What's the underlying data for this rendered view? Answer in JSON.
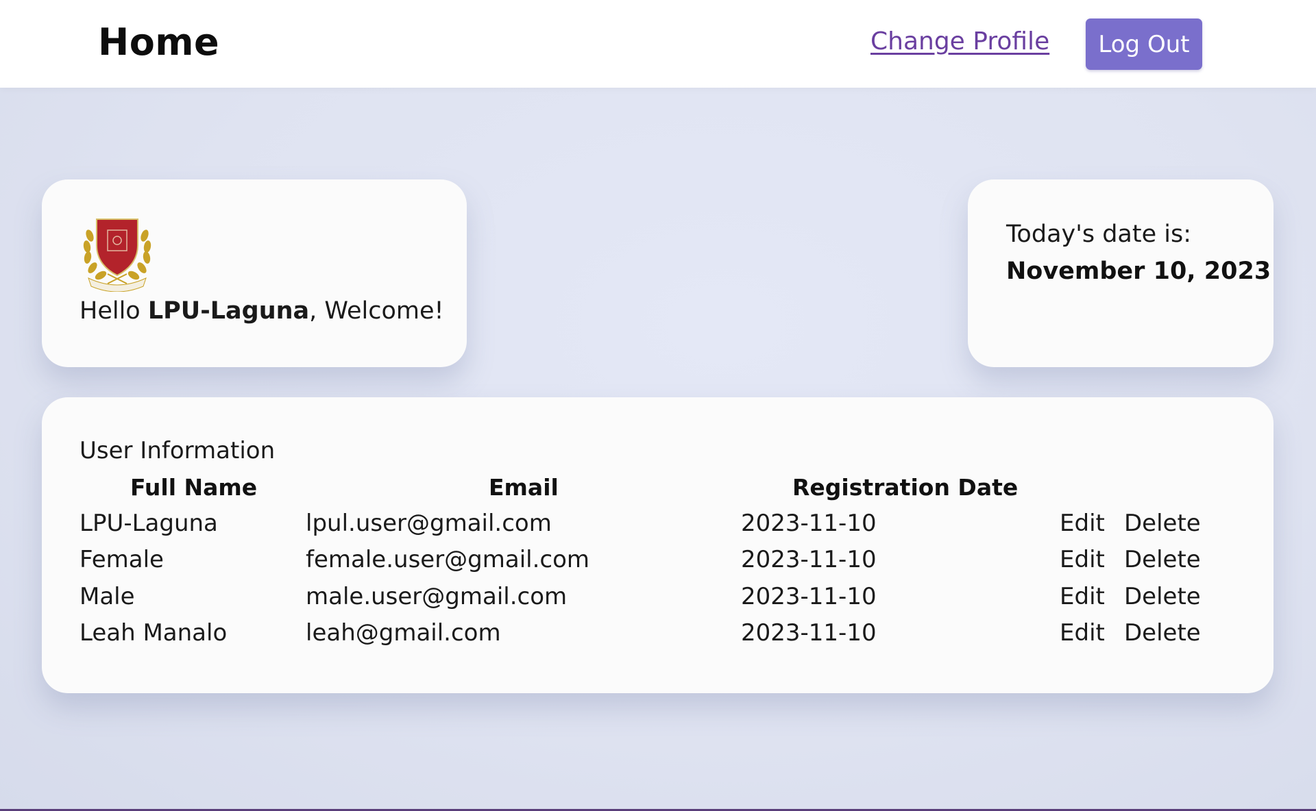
{
  "header": {
    "title": "Home",
    "change_profile_label": "Change Profile",
    "logout_label": "Log Out"
  },
  "welcome": {
    "greeting_prefix": "Hello ",
    "username": "LPU-Laguna",
    "greeting_suffix": ", Welcome!",
    "logo_icon": "university-crest-icon"
  },
  "date_card": {
    "label": "Today's date is:",
    "value": "November 10, 2023"
  },
  "users": {
    "heading": "User Information",
    "columns": [
      "Full Name",
      "Email",
      "Registration Date"
    ],
    "rows": [
      {
        "name": "LPU-Laguna",
        "email": "lpul.user@gmail.com",
        "date": "2023-11-10",
        "edit": "Edit",
        "delete": "Delete"
      },
      {
        "name": "Female",
        "email": "female.user@gmail.com",
        "date": "2023-11-10",
        "edit": "Edit",
        "delete": "Delete"
      },
      {
        "name": "Male",
        "email": "male.user@gmail.com",
        "date": "2023-11-10",
        "edit": "Edit",
        "delete": "Delete"
      },
      {
        "name": "Leah Manalo",
        "email": "leah@gmail.com",
        "date": "2023-11-10",
        "edit": "Edit",
        "delete": "Delete"
      }
    ]
  },
  "colors": {
    "accent": "#7a6fcc",
    "link": "#6a3fa0",
    "background": "#e3e7f5",
    "crest_red": "#b3232b",
    "crest_gold": "#c9a227"
  }
}
